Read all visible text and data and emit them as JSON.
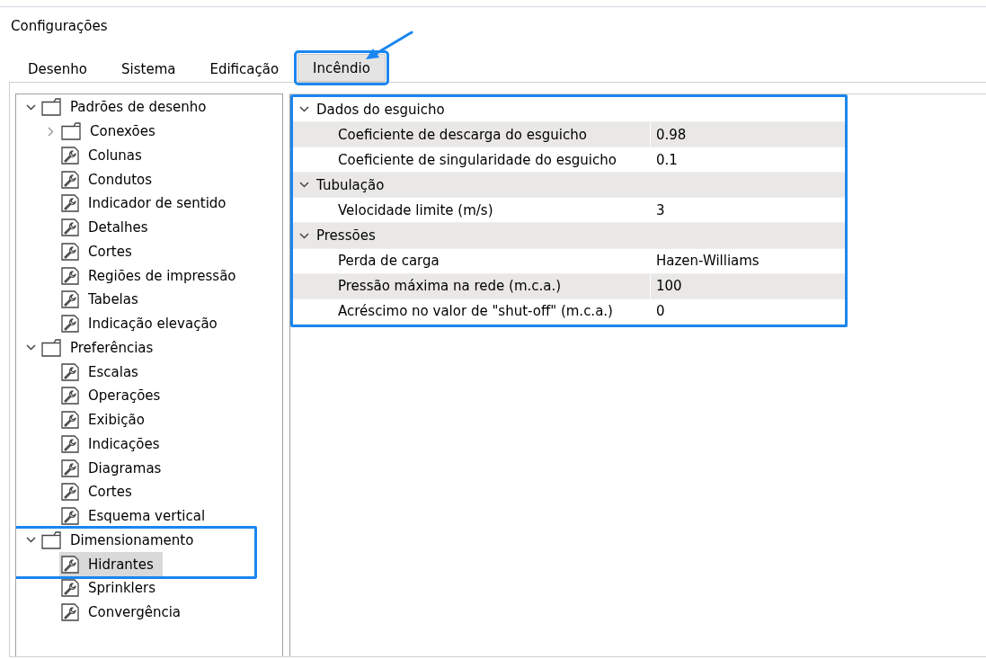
{
  "window": {
    "title": "Configurações"
  },
  "tabs": [
    {
      "label": "Desenho",
      "selected": false,
      "highlighted": false
    },
    {
      "label": "Sistema",
      "selected": false,
      "highlighted": false
    },
    {
      "label": "Edificação",
      "selected": false,
      "highlighted": false
    },
    {
      "label": "Incêndio",
      "selected": true,
      "highlighted": true
    }
  ],
  "tree": [
    {
      "kind": "folder",
      "label": "Padrões de desenho",
      "expanded": true,
      "highlighted": false,
      "children": [
        {
          "kind": "folder",
          "label": "Conexões",
          "expanded": false,
          "highlighted": false
        },
        {
          "kind": "item",
          "label": "Colunas",
          "selected": false,
          "highlighted": false
        },
        {
          "kind": "item",
          "label": "Condutos",
          "selected": false,
          "highlighted": false
        },
        {
          "kind": "item",
          "label": "Indicador de sentido",
          "selected": false,
          "highlighted": false
        },
        {
          "kind": "item",
          "label": "Detalhes",
          "selected": false,
          "highlighted": false
        },
        {
          "kind": "item",
          "label": "Cortes",
          "selected": false,
          "highlighted": false
        },
        {
          "kind": "item",
          "label": "Regiões de impressão",
          "selected": false,
          "highlighted": false
        },
        {
          "kind": "item",
          "label": "Tabelas",
          "selected": false,
          "highlighted": false
        },
        {
          "kind": "item",
          "label": "Indicação elevação",
          "selected": false,
          "highlighted": false
        }
      ]
    },
    {
      "kind": "folder",
      "label": "Preferências",
      "expanded": true,
      "highlighted": false,
      "children": [
        {
          "kind": "item",
          "label": "Escalas",
          "selected": false,
          "highlighted": false
        },
        {
          "kind": "item",
          "label": "Operações",
          "selected": false,
          "highlighted": false
        },
        {
          "kind": "item",
          "label": "Exibição",
          "selected": false,
          "highlighted": false
        },
        {
          "kind": "item",
          "label": "Indicações",
          "selected": false,
          "highlighted": false
        },
        {
          "kind": "item",
          "label": "Diagramas",
          "selected": false,
          "highlighted": false
        },
        {
          "kind": "item",
          "label": "Cortes",
          "selected": false,
          "highlighted": false
        },
        {
          "kind": "item",
          "label": "Esquema vertical",
          "selected": false,
          "highlighted": false
        }
      ]
    },
    {
      "kind": "folder",
      "label": "Dimensionamento",
      "expanded": true,
      "highlighted": true,
      "children": [
        {
          "kind": "item",
          "label": "Hidrantes",
          "selected": true,
          "highlighted": true
        },
        {
          "kind": "item",
          "label": "Sprinklers",
          "selected": false,
          "highlighted": false
        },
        {
          "kind": "item",
          "label": "Convergência",
          "selected": false,
          "highlighted": false
        }
      ]
    }
  ],
  "property_grid": {
    "highlighted": true,
    "sections": [
      {
        "label": "Dados do esguicho",
        "expanded": true,
        "properties": [
          {
            "name": "Coeficiente de descarga do esguicho",
            "value": "0.98"
          },
          {
            "name": "Coeficiente de singularidade do esguicho",
            "value": "0.1"
          }
        ]
      },
      {
        "label": "Tubulação",
        "expanded": true,
        "properties": [
          {
            "name": "Velocidade limite (m/s)",
            "value": "3"
          }
        ]
      },
      {
        "label": "Pressões",
        "expanded": true,
        "properties": [
          {
            "name": "Perda de carga",
            "value": "Hazen-Williams"
          },
          {
            "name": "Pressão máxima na rede (m.c.a.)",
            "value": "100"
          },
          {
            "name": "Acréscimo no valor de \"shut-off\" (m.c.a.)",
            "value": "0"
          }
        ]
      }
    ]
  }
}
